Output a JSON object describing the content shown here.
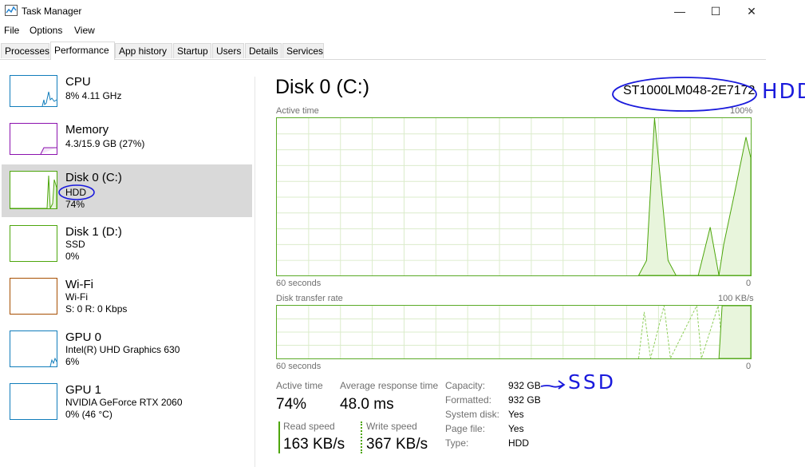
{
  "window": {
    "title": "Task Manager",
    "minimize": "—",
    "maximize": "☐",
    "close": "✕"
  },
  "menu": [
    "File",
    "Options",
    "View"
  ],
  "tabs": [
    "Processes",
    "Performance",
    "App history",
    "Startup",
    "Users",
    "Details",
    "Services"
  ],
  "active_tab": "Performance",
  "sidebar": [
    {
      "name": "CPU",
      "line1": "8%  4.11 GHz",
      "color": "#117dbb"
    },
    {
      "name": "Memory",
      "line1": "4.3/15.9 GB (27%)",
      "color": "#8b12ae"
    },
    {
      "name": "Disk 0 (C:)",
      "line1": "HDD",
      "line2": "74%",
      "color": "#4da60c",
      "selected": true
    },
    {
      "name": "Disk 1 (D:)",
      "line1": "SSD",
      "line2": "0%",
      "color": "#4da60c"
    },
    {
      "name": "Wi-Fi",
      "line1": "Wi-Fi",
      "line2": "S: 0  R: 0 Kbps",
      "color": "#a74f01"
    },
    {
      "name": "GPU 0",
      "line1": "Intel(R) UHD Graphics 630",
      "line2": "6%",
      "color": "#117dbb"
    },
    {
      "name": "GPU 1",
      "line1": "NVIDIA GeForce RTX 2060",
      "line2": "0% (46 °C)",
      "color": "#117dbb"
    }
  ],
  "main": {
    "title": "Disk 0 (C:)",
    "model": "ST1000LM048-2E7172",
    "active_time_graph": {
      "label": "Active time",
      "max": "100%",
      "time": "60 seconds",
      "min": "0"
    },
    "transfer_graph": {
      "label": "Disk transfer rate",
      "max": "100 KB/s",
      "time": "60 seconds",
      "min": "0"
    },
    "stats": {
      "active_time_label": "Active time",
      "active_time": "74%",
      "avg_response_label": "Average response time",
      "avg_response": "48.0 ms",
      "read_label": "Read speed",
      "read": "163 KB/s",
      "write_label": "Write speed",
      "write": "367 KB/s"
    },
    "properties": [
      {
        "label": "Capacity:",
        "value": "932 GB"
      },
      {
        "label": "Formatted:",
        "value": "932 GB"
      },
      {
        "label": "System disk:",
        "value": "Yes"
      },
      {
        "label": "Page file:",
        "value": "Yes"
      },
      {
        "label": "Type:",
        "value": "HDD"
      }
    ]
  },
  "annotations": {
    "model_note": "HDD",
    "capacity_note": "SSD",
    "color": "#1a1adc"
  },
  "accent": "#4da60c"
}
